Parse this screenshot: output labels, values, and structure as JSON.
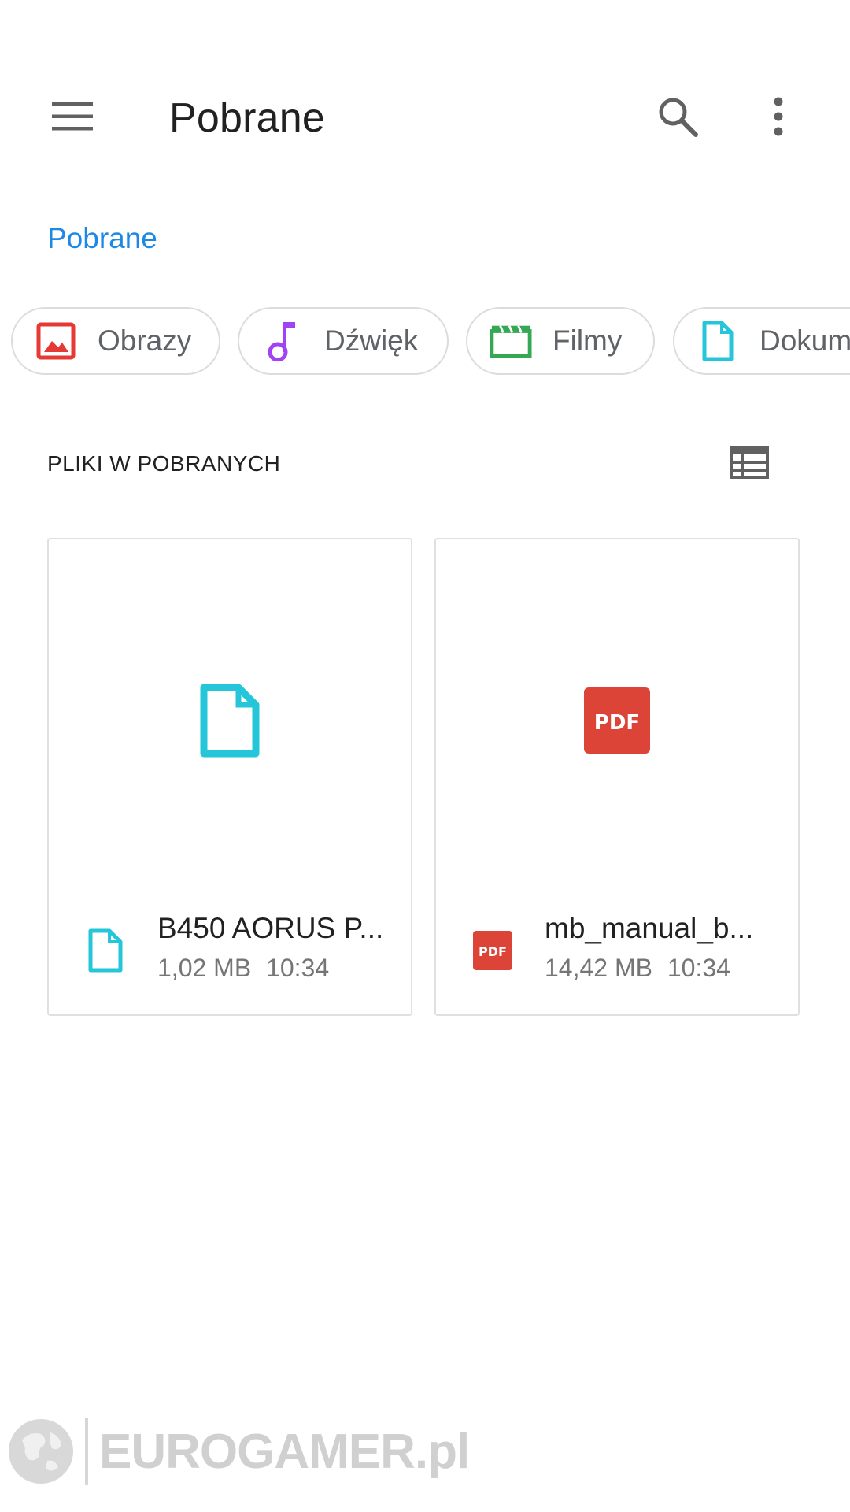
{
  "appbar": {
    "title": "Pobrane",
    "menu_icon": "menu-icon",
    "search_icon": "search-icon",
    "more_icon": "more-vert-icon"
  },
  "breadcrumb": {
    "label": "Pobrane"
  },
  "categories": [
    {
      "label": "Obrazy",
      "icon": "image-icon",
      "color": "#e53935"
    },
    {
      "label": "Dźwięk",
      "icon": "music-note-icon",
      "color": "#a142f4"
    },
    {
      "label": "Filmy",
      "icon": "movie-clapper-icon",
      "color": "#34a853"
    },
    {
      "label": "Dokum",
      "icon": "document-icon",
      "color": "#26c6da"
    }
  ],
  "section": {
    "title": "PLIKI W POBRANYCH",
    "view_toggle_icon": "list-view-icon"
  },
  "files": [
    {
      "name": "B450 AORUS P...",
      "size": "1,02 MB",
      "time": "10:34",
      "icon": "document-icon",
      "color": "#26c6da"
    },
    {
      "name": "mb_manual_b...",
      "size": "14,42 MB",
      "time": "10:34",
      "icon": "pdf-icon",
      "color": "#db4437",
      "badge": "PDF"
    }
  ],
  "watermark": {
    "text": "EUROGAMER.pl"
  }
}
